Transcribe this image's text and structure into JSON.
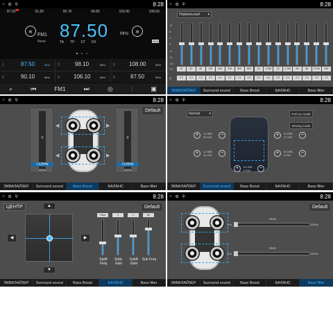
{
  "status_bar": {
    "time": "8:28"
  },
  "radio": {
    "scale": [
      "87.50",
      "91.60",
      "95.70",
      "99.80",
      "103.90",
      "108.00"
    ],
    "band": "FM1",
    "frequency": "87.50",
    "unit": "MHz",
    "station": "None",
    "flags": [
      "TA",
      "TP",
      "ST",
      "DX"
    ],
    "rds": "RDS",
    "presets": [
      {
        "num": "1",
        "freq": "87.50",
        "unit": "MHz"
      },
      {
        "num": "2",
        "freq": "90.10",
        "unit": "MHz"
      },
      {
        "num": "3",
        "freq": "98.10",
        "unit": "MHz"
      },
      {
        "num": "4",
        "freq": "106.10",
        "unit": "MHz"
      },
      {
        "num": "5",
        "freq": "108.00",
        "unit": "MHz"
      },
      {
        "num": "6",
        "freq": "87.50",
        "unit": "MHz"
      }
    ],
    "bottom_label": "FM1"
  },
  "eq": {
    "preset": "Нормальный",
    "scale": [
      "12",
      "8",
      "4",
      "0",
      "-4",
      "-8",
      "-12"
    ],
    "fc_label": "FC",
    "q_label": "Q",
    "freqs": [
      "20",
      "30",
      "80",
      "125",
      "200",
      "315",
      "500",
      "800",
      "1K",
      "1.25K",
      "2K",
      "3.15K",
      "5K",
      "8K",
      "12.5K",
      "16K"
    ],
    "q": [
      "2.2",
      "2.2",
      "2.2",
      "2.2",
      "2.2",
      "2.2",
      "2.2",
      "2.2",
      "2.2",
      "2.2",
      "2.2",
      "2.2",
      "2.2",
      "2.2",
      "2.2",
      "2.2"
    ],
    "levels": [
      0.5,
      0.5,
      0.5,
      0.5,
      0.5,
      0.5,
      0.5,
      0.5,
      0.5,
      0.5,
      0.5,
      0.5,
      0.5,
      0.5,
      0.5,
      0.5
    ]
  },
  "tabs": [
    "ЭКВАЛАЙЗЕР",
    "Surround sound",
    "Bass Boost",
    "БАЛАНС",
    "Bass filter"
  ],
  "bass_boost": {
    "default_label": "Default",
    "left": {
      "value": "0",
      "freq": "<125Hz",
      "bottom": "150Hz"
    },
    "right": {
      "value": "0",
      "freq": "<125Hz",
      "bottom": "100Hz"
    }
  },
  "surround": {
    "mode": "Normal",
    "buttons": [
      "Full car mode",
      "Driving mode"
    ],
    "readouts": {
      "fl": [
        "1.0 MS",
        "30 CM"
      ],
      "fr": [
        "0.0 MS",
        "17 CM"
      ],
      "rl": [
        "1.0 MS",
        "31 CM"
      ],
      "rr": [
        "0.0 MS",
        "0 CM"
      ],
      "sub": [
        "0.0 MS",
        "0 CM"
      ]
    }
  },
  "balance": {
    "center_label": "ЦЕНТР",
    "default_label": "Default",
    "faders": [
      {
        "label": "Spdif Freq",
        "top": "Heat",
        "level": 0.35
      },
      {
        "label": "SubL Gain",
        "top": "1",
        "level": 0.55
      },
      {
        "label": "SubR Gain",
        "top": "1",
        "level": 0.55
      },
      {
        "label": "Sub Freq",
        "top": "80",
        "level": 0.75
      }
    ]
  },
  "bass_filter": {
    "default_label": "Default",
    "rows": [
      {
        "title": "PASS",
        "left": "1Hz",
        "right": "200Hz"
      },
      {
        "title": "PASS",
        "left": "1Hz",
        "right": "200Hz"
      }
    ]
  }
}
